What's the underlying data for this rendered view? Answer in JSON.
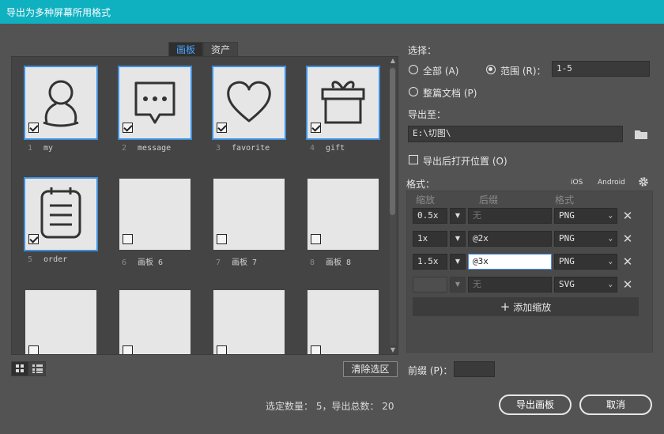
{
  "window": {
    "title": "导出为多种屏幕所用格式"
  },
  "tabs": [
    {
      "label": "画板"
    },
    {
      "label": "资产"
    }
  ],
  "artboards": [
    {
      "num": "1",
      "name": "my",
      "selected": true,
      "icon": "user-icon"
    },
    {
      "num": "2",
      "name": "message",
      "selected": true,
      "icon": "message-icon"
    },
    {
      "num": "3",
      "name": "favorite",
      "selected": true,
      "icon": "heart-icon"
    },
    {
      "num": "4",
      "name": "gift",
      "selected": true,
      "icon": "gift-icon"
    },
    {
      "num": "5",
      "name": "order",
      "selected": true,
      "icon": "clipboard-icon"
    },
    {
      "num": "6",
      "name": "画板 6",
      "selected": false
    },
    {
      "num": "7",
      "name": "画板 7",
      "selected": false
    },
    {
      "num": "8",
      "name": "画板 8",
      "selected": false
    }
  ],
  "buttons": {
    "clear_selection": "清除选区",
    "export": "导出画板",
    "cancel": "取消"
  },
  "status": {
    "text": "选定数量： 5，导出总数： 20"
  },
  "select": {
    "label": "选择：",
    "all": "全部 (A)",
    "range": "范围 (R)：",
    "range_value": "1-5",
    "whole_doc": "整篇文档 (P)"
  },
  "export_to": {
    "label": "导出至：",
    "path": "E:\\切图\\",
    "open_after": "导出后打开位置 (O)"
  },
  "formats": {
    "label": "格式：",
    "ios": "iOS",
    "android": "Android",
    "headers": {
      "scale": "缩放",
      "suffix": "后缀",
      "format": "格式"
    },
    "rows": [
      {
        "scale": "0.5x",
        "suffix": "",
        "suffix_placeholder": "无",
        "format": "PNG"
      },
      {
        "scale": "1x",
        "suffix": "@2x",
        "suffix_placeholder": "",
        "format": "PNG"
      },
      {
        "scale": "1.5x",
        "suffix": "@3x",
        "suffix_placeholder": "",
        "format": "PNG"
      },
      {
        "scale": "",
        "suffix": "",
        "suffix_placeholder": "无",
        "format": "SVG"
      }
    ],
    "add_scale": "添加缩放"
  },
  "prefix": {
    "label": "前缀 (P)：",
    "value": ""
  }
}
